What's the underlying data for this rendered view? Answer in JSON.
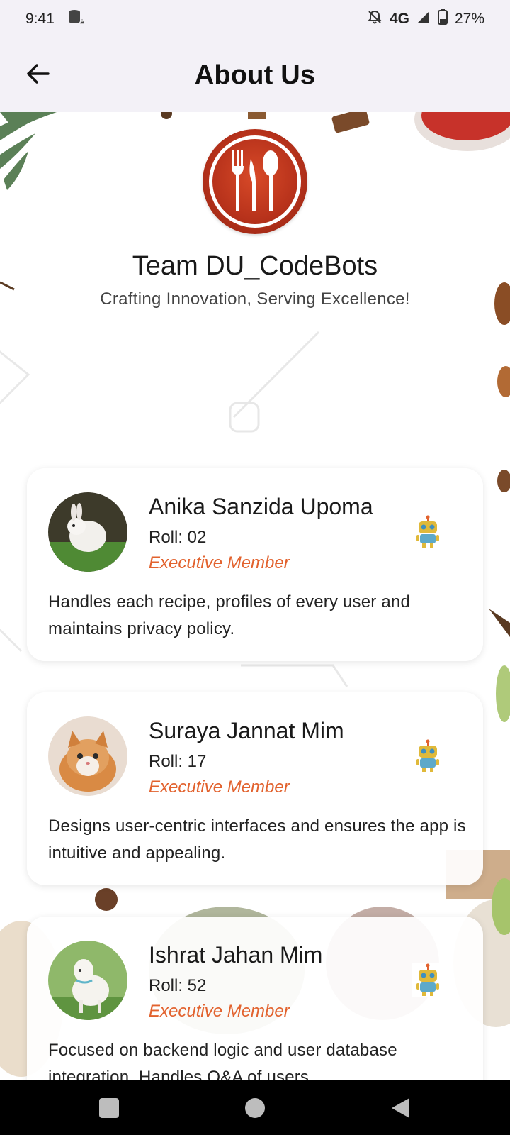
{
  "status_bar": {
    "time": "9:41",
    "network": "4G",
    "battery": "27%"
  },
  "app_bar": {
    "title": "About Us"
  },
  "header": {
    "team_name": "Team DU_CodeBots",
    "tagline": "Crafting Innovation, Serving Excellence!"
  },
  "members": [
    {
      "name": "Anika Sanzida Upoma",
      "roll": "Roll: 02",
      "role": "Executive Member",
      "description": "Handles each recipe, profiles of every user and maintains privacy policy."
    },
    {
      "name": "Suraya Jannat Mim",
      "roll": "Roll: 17",
      "role": "Executive Member",
      "description": "Designs user-centric interfaces and ensures the app is intuitive and appealing."
    },
    {
      "name": "Ishrat Jahan Mim",
      "roll": "Roll: 52",
      "role": "Executive Member",
      "description": "Focused on backend logic and user database integration. Handles Q&A of users."
    }
  ],
  "colors": {
    "accent": "#e2622e",
    "logo_red": "#b7321b",
    "app_bar_bg": "#f3f1f7"
  },
  "icons": {
    "back": "arrow-left-icon",
    "member_badge": "robot-icon",
    "logo": "fork-knife-spoon-icon"
  }
}
